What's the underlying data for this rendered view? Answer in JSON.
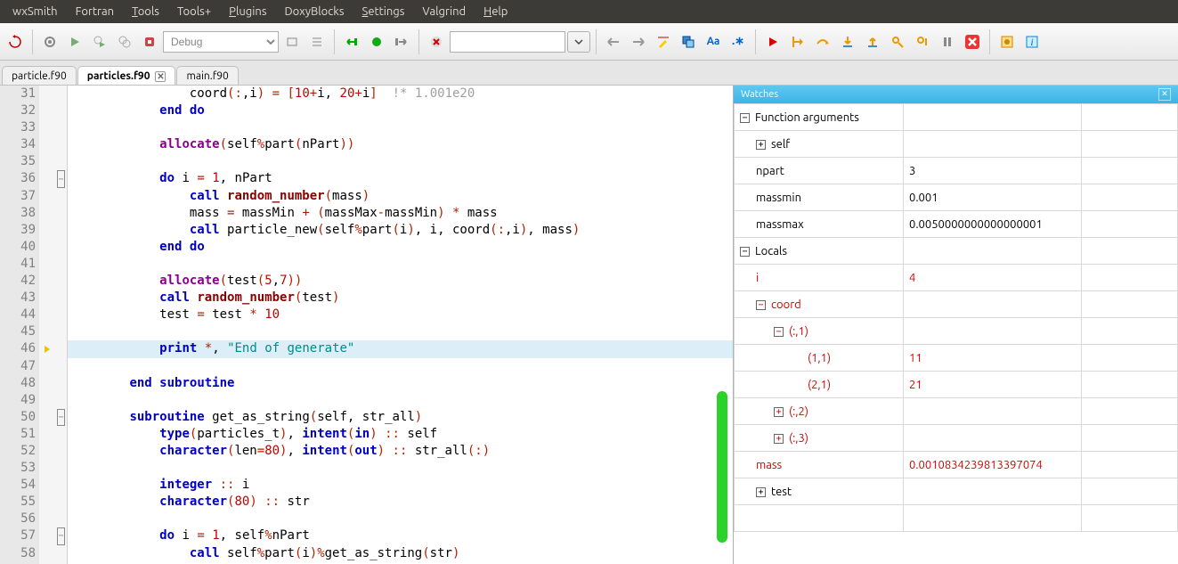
{
  "menubar": [
    {
      "u": "",
      "label": "wxSmith"
    },
    {
      "u": "",
      "label": "Fortran"
    },
    {
      "u": "T",
      "label": "ools"
    },
    {
      "u": "",
      "label": "Tools+"
    },
    {
      "u": "P",
      "label": "lugins"
    },
    {
      "u": "",
      "label": "DoxyBlocks"
    },
    {
      "u": "S",
      "label": "ettings"
    },
    {
      "u": "",
      "label": "Valgrind"
    },
    {
      "u": "H",
      "label": "elp"
    }
  ],
  "toolbar": {
    "target_value": "Debug"
  },
  "tabs": [
    {
      "label": "particle.f90",
      "active": false,
      "close": false
    },
    {
      "label": "particles.f90",
      "active": true,
      "close": true
    },
    {
      "label": "main.f90",
      "active": false,
      "close": false
    }
  ],
  "editor": {
    "first_line": 31,
    "current_line": 46,
    "fold_minus_lines": [
      36,
      50,
      57
    ],
    "lines_html": [
      "                <span class='id'>coord</span><span class='op'>(:</span><span class='id'>,i</span><span class='op'>)</span> <span class='op'>=</span> <span class='op'>[</span><span class='num'>10</span><span class='op'>+</span><span class='id'>i</span><span class='id'>,</span> <span class='num'>20</span><span class='op'>+</span><span class='id'>i</span><span class='op'>]</span>  <span class='cmt'>!* 1.001e20</span>",
      "            <span class='kw'>end</span> <span class='kw'>do</span>",
      "",
      "            <span class='kw2'>allocate</span><span class='op'>(</span><span class='id'>self</span><span class='op'>%</span><span class='id'>part</span><span class='op'>(</span><span class='id'>nPart</span><span class='op'>))</span>",
      "",
      "            <span class='kw'>do</span> <span class='id'>i</span> <span class='op'>=</span> <span class='num'>1</span><span class='id'>,</span> <span class='id'>nPart</span>",
      "                <span class='kw'>call</span> <span class='fn'>random_number</span><span class='op'>(</span><span class='id'>mass</span><span class='op'>)</span>",
      "                <span class='id'>mass</span> <span class='op'>=</span> <span class='id'>massMin</span> <span class='op'>+</span> <span class='op'>(</span><span class='id'>massMax</span><span class='op'>-</span><span class='id'>massMin</span><span class='op'>)</span> <span class='op'>*</span> <span class='id'>mass</span>",
      "                <span class='kw'>call</span> <span class='id'>particle_new</span><span class='op'>(</span><span class='id'>self</span><span class='op'>%</span><span class='id'>part</span><span class='op'>(</span><span class='id'>i</span><span class='op'>)</span><span class='id'>,</span> <span class='id'>i</span><span class='id'>,</span> <span class='id'>coord</span><span class='op'>(:</span><span class='id'>,i</span><span class='op'>)</span><span class='id'>,</span> <span class='id'>mass</span><span class='op'>)</span>",
      "            <span class='kw'>end</span> <span class='kw'>do</span>",
      "",
      "            <span class='kw2'>allocate</span><span class='op'>(</span><span class='id'>test</span><span class='op'>(</span><span class='num'>5</span><span class='id'>,</span><span class='num'>7</span><span class='op'>))</span>",
      "            <span class='kw'>call</span> <span class='fn'>random_number</span><span class='op'>(</span><span class='id'>test</span><span class='op'>)</span>",
      "            <span class='id'>test</span> <span class='op'>=</span> <span class='id'>test</span> <span class='op'>*</span> <span class='num'>10</span>",
      "",
      "            <span class='kw'>print</span> <span class='op'>*</span><span class='id'>,</span> <span class='str'>\"End of generate\"</span>",
      "",
      "        <span class='kw'>end</span> <span class='kw'>subroutine</span>",
      "",
      "        <span class='kw'>subroutine</span> <span class='id'>get_as_string</span><span class='op'>(</span><span class='id'>self</span><span class='id'>,</span> <span class='id'>str_all</span><span class='op'>)</span>",
      "            <span class='kw'>type</span><span class='op'>(</span><span class='id'>particles_t</span><span class='op'>)</span><span class='id'>,</span> <span class='kw'>intent</span><span class='op'>(</span><span class='kw'>in</span><span class='op'>)</span> <span class='op'>::</span> <span class='id'>self</span>",
      "            <span class='kw'>character</span><span class='op'>(</span><span class='id'>len</span><span class='op'>=</span><span class='num'>80</span><span class='op'>)</span><span class='id'>,</span> <span class='kw'>intent</span><span class='op'>(</span><span class='kw'>out</span><span class='op'>)</span> <span class='op'>::</span> <span class='id'>str_all</span><span class='op'>(:)</span>",
      "",
      "            <span class='kw'>integer</span> <span class='op'>::</span> <span class='id'>i</span>",
      "            <span class='kw'>character</span><span class='op'>(</span><span class='num'>80</span><span class='op'>)</span> <span class='op'>::</span> <span class='id'>str</span>",
      "",
      "            <span class='kw'>do</span> <span class='id'>i</span> <span class='op'>=</span> <span class='num'>1</span><span class='id'>,</span> <span class='id'>self</span><span class='op'>%</span><span class='id'>nPart</span>",
      "                <span class='kw'>call</span> <span class='id'>self</span><span class='op'>%</span><span class='id'>part</span><span class='op'>(</span><span class='id'>i</span><span class='op'>)%</span><span class='id'>get_as_string</span><span class='op'>(</span><span class='id'>str</span><span class='op'>)</span>"
    ]
  },
  "watches": {
    "title": "Watches",
    "rows": [
      {
        "indent": 0,
        "exp": "-",
        "name": "Function arguments",
        "value": "",
        "red": false
      },
      {
        "indent": 1,
        "exp": "+",
        "name": "self",
        "value": "",
        "red": false
      },
      {
        "indent": 1,
        "exp": "",
        "name": "npart",
        "value": "3",
        "red": false
      },
      {
        "indent": 1,
        "exp": "",
        "name": "massmin",
        "value": "0.001",
        "red": false
      },
      {
        "indent": 1,
        "exp": "",
        "name": "massmax",
        "value": "0.0050000000000000001",
        "red": false
      },
      {
        "indent": 0,
        "exp": "-",
        "name": "Locals",
        "value": "",
        "red": false
      },
      {
        "indent": 1,
        "exp": "",
        "name": "i",
        "value": "4",
        "red": true
      },
      {
        "indent": 1,
        "exp": "-",
        "name": "coord",
        "value": "",
        "red": true
      },
      {
        "indent": 2,
        "exp": "-",
        "name": "(:,1)",
        "value": "",
        "red": true
      },
      {
        "indent": 3,
        "exp": "",
        "name": "(1,1)",
        "value": "11",
        "red": true
      },
      {
        "indent": 3,
        "exp": "",
        "name": "(2,1)",
        "value": "21",
        "red": true
      },
      {
        "indent": 2,
        "exp": "+",
        "name": "(:,2)",
        "value": "",
        "red": true
      },
      {
        "indent": 2,
        "exp": "+",
        "name": "(:,3)",
        "value": "",
        "red": true
      },
      {
        "indent": 1,
        "exp": "",
        "name": "mass",
        "value": "0.0010834239813397074",
        "red": true
      },
      {
        "indent": 1,
        "exp": "+",
        "name": "test",
        "value": "",
        "red": false
      },
      {
        "indent": 1,
        "exp": "",
        "name": "",
        "value": "",
        "red": false
      }
    ]
  }
}
